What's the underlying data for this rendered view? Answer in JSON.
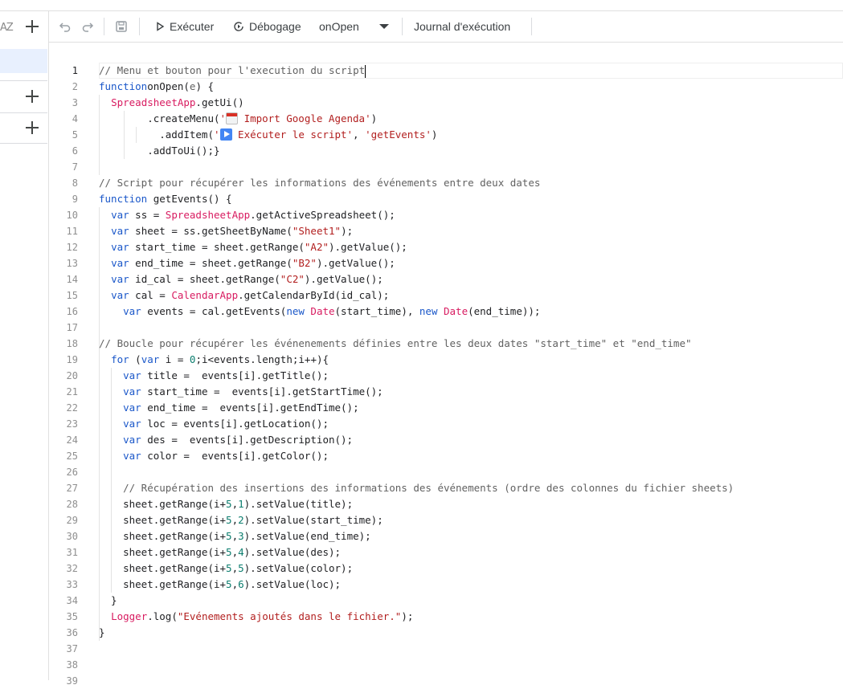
{
  "sidebar": {
    "sort_label": "AZ"
  },
  "toolbar": {
    "run_label": "Exécuter",
    "debug_label": "Débogage",
    "function_selected": "onOpen",
    "log_label": "Journal d'exécution"
  },
  "editor": {
    "lines": [
      [
        [
          "cm",
          "// Menu et bouton pour l'execution du script"
        ]
      ],
      [
        [
          "kw",
          "function"
        ],
        [
          "",
          "onOpen("
        ],
        [
          "cm",
          "e"
        ],
        [
          "",
          ") {"
        ]
      ],
      [
        [
          "",
          "  "
        ],
        [
          "cls",
          "SpreadsheetApp"
        ],
        [
          "",
          ".getUi()"
        ]
      ],
      [
        [
          "",
          "        .createMenu("
        ],
        [
          "str",
          "'"
        ],
        [
          "emoji",
          "calendar"
        ],
        [
          "str",
          " Import Google Agenda'"
        ],
        [
          "",
          ")"
        ]
      ],
      [
        [
          "",
          "          .addItem("
        ],
        [
          "str",
          "'"
        ],
        [
          "emoji",
          "play"
        ],
        [
          "str",
          " Exécuter le script'"
        ],
        [
          "",
          ", "
        ],
        [
          "str",
          "'getEvents'"
        ],
        [
          "",
          ")"
        ]
      ],
      [
        [
          "",
          "        .addToUi();}"
        ]
      ],
      [
        [
          "",
          ""
        ]
      ],
      [
        [
          "cm",
          "// Script pour récupérer les informations des événements entre deux dates"
        ]
      ],
      [
        [
          "kw",
          "function"
        ],
        [
          "",
          " getEvents() {"
        ]
      ],
      [
        [
          "",
          "  "
        ],
        [
          "kw",
          "var"
        ],
        [
          "",
          " ss = "
        ],
        [
          "cls",
          "SpreadsheetApp"
        ],
        [
          "",
          ".getActiveSpreadsheet();"
        ]
      ],
      [
        [
          "",
          "  "
        ],
        [
          "kw",
          "var"
        ],
        [
          "",
          " sheet = ss.getSheetByName("
        ],
        [
          "str",
          "\"Sheet1\""
        ],
        [
          "",
          ");"
        ]
      ],
      [
        [
          "",
          "  "
        ],
        [
          "kw",
          "var"
        ],
        [
          "",
          " start_time = sheet.getRange("
        ],
        [
          "str",
          "\"A2\""
        ],
        [
          "",
          ").getValue();"
        ]
      ],
      [
        [
          "",
          "  "
        ],
        [
          "kw",
          "var"
        ],
        [
          "",
          " end_time = sheet.getRange("
        ],
        [
          "str",
          "\"B2\""
        ],
        [
          "",
          ").getValue();"
        ]
      ],
      [
        [
          "",
          "  "
        ],
        [
          "kw",
          "var"
        ],
        [
          "",
          " id_cal = sheet.getRange("
        ],
        [
          "str",
          "\"C2\""
        ],
        [
          "",
          ").getValue();"
        ]
      ],
      [
        [
          "",
          "  "
        ],
        [
          "kw",
          "var"
        ],
        [
          "",
          " cal = "
        ],
        [
          "cls",
          "CalendarApp"
        ],
        [
          "",
          ".getCalendarById(id_cal);"
        ]
      ],
      [
        [
          "",
          "    "
        ],
        [
          "kw",
          "var"
        ],
        [
          "",
          " events = cal.getEvents("
        ],
        [
          "kw",
          "new"
        ],
        [
          "cls",
          " Date"
        ],
        [
          "",
          "(start_time), "
        ],
        [
          "kw",
          "new"
        ],
        [
          "cls",
          " Date"
        ],
        [
          "",
          "(end_time));"
        ]
      ],
      [
        [
          "",
          ""
        ]
      ],
      [
        [
          "cm",
          "// Boucle pour récupérer les événenements définies entre les deux dates \"start_time\" et \"end_time\""
        ]
      ],
      [
        [
          "",
          "  "
        ],
        [
          "kw",
          "for"
        ],
        [
          "",
          " ("
        ],
        [
          "kw",
          "var"
        ],
        [
          "",
          " i = "
        ],
        [
          "num",
          "0"
        ],
        [
          "",
          ";i<events.length;i++){"
        ]
      ],
      [
        [
          "",
          "    "
        ],
        [
          "kw",
          "var"
        ],
        [
          "",
          " title =  events[i].getTitle();"
        ]
      ],
      [
        [
          "",
          "    "
        ],
        [
          "kw",
          "var"
        ],
        [
          "",
          " start_time =  events[i].getStartTime();"
        ]
      ],
      [
        [
          "",
          "    "
        ],
        [
          "kw",
          "var"
        ],
        [
          "",
          " end_time =  events[i].getEndTime();"
        ]
      ],
      [
        [
          "",
          "    "
        ],
        [
          "kw",
          "var"
        ],
        [
          "",
          " loc = events[i].getLocation();"
        ]
      ],
      [
        [
          "",
          "    "
        ],
        [
          "kw",
          "var"
        ],
        [
          "",
          " des =  events[i].getDescription();"
        ]
      ],
      [
        [
          "",
          "    "
        ],
        [
          "kw",
          "var"
        ],
        [
          "",
          " color =  events[i].getColor();"
        ]
      ],
      [
        [
          "",
          ""
        ]
      ],
      [
        [
          "",
          "    "
        ],
        [
          "cm",
          "// Récupération des insertions des informations des événements (ordre des colonnes du fichier sheets)"
        ]
      ],
      [
        [
          "",
          "    sheet.getRange(i+"
        ],
        [
          "num",
          "5"
        ],
        [
          "",
          ","
        ],
        [
          "num",
          "1"
        ],
        [
          "",
          ").setValue(title);"
        ]
      ],
      [
        [
          "",
          "    sheet.getRange(i+"
        ],
        [
          "num",
          "5"
        ],
        [
          "",
          ","
        ],
        [
          "num",
          "2"
        ],
        [
          "",
          ").setValue(start_time);"
        ]
      ],
      [
        [
          "",
          "    sheet.getRange(i+"
        ],
        [
          "num",
          "5"
        ],
        [
          "",
          ","
        ],
        [
          "num",
          "3"
        ],
        [
          "",
          ").setValue(end_time);"
        ]
      ],
      [
        [
          "",
          "    sheet.getRange(i+"
        ],
        [
          "num",
          "5"
        ],
        [
          "",
          ","
        ],
        [
          "num",
          "4"
        ],
        [
          "",
          ").setValue(des);"
        ]
      ],
      [
        [
          "",
          "    sheet.getRange(i+"
        ],
        [
          "num",
          "5"
        ],
        [
          "",
          ","
        ],
        [
          "num",
          "5"
        ],
        [
          "",
          ").setValue(color);"
        ]
      ],
      [
        [
          "",
          "    sheet.getRange(i+"
        ],
        [
          "num",
          "5"
        ],
        [
          "",
          ","
        ],
        [
          "num",
          "6"
        ],
        [
          "",
          ").setValue(loc);"
        ]
      ],
      [
        [
          "",
          "  }"
        ]
      ],
      [
        [
          "",
          "  "
        ],
        [
          "cls",
          "Logger"
        ],
        [
          "",
          ".log("
        ],
        [
          "str",
          "\"Evénements ajoutés dans le fichier.\""
        ],
        [
          "",
          ");"
        ]
      ],
      [
        [
          "",
          "}"
        ]
      ],
      [
        [
          "",
          ""
        ]
      ],
      [
        [
          "",
          ""
        ]
      ],
      [
        [
          "",
          ""
        ]
      ]
    ]
  }
}
